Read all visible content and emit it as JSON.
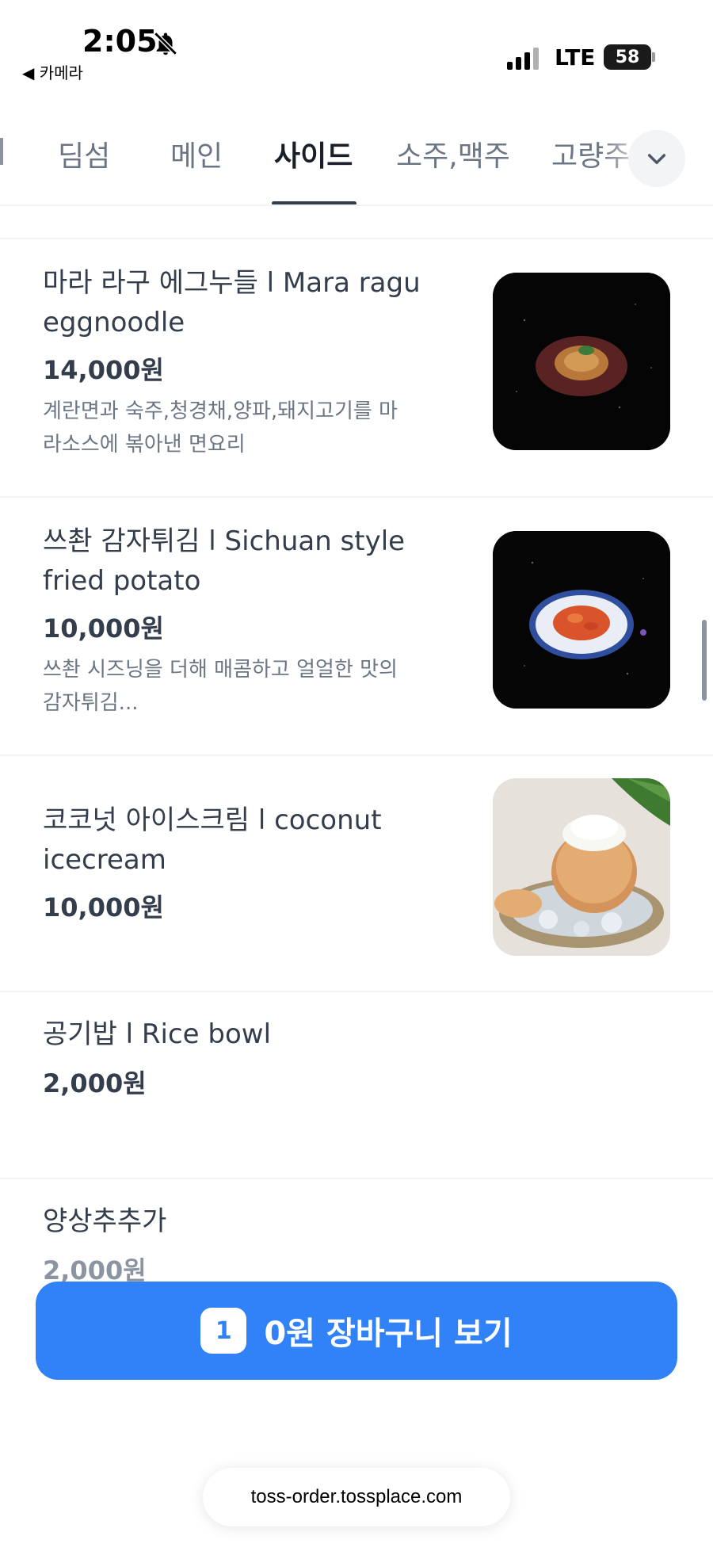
{
  "status_bar": {
    "time": "2:05",
    "back_app": "◀ 카메라",
    "network": "LTE",
    "battery": "58"
  },
  "tabs": [
    {
      "label": "딤섬"
    },
    {
      "label": "메인"
    },
    {
      "label": "사이드",
      "active": true
    },
    {
      "label": "소주,맥주"
    },
    {
      "label": "고량주"
    }
  ],
  "menu_items": [
    {
      "name": "마라 라구 에그누들 l Mara ragu eggnoodle",
      "price": "14,000원",
      "description": "계란면과 숙주,청경채,양파,돼지고기를 마라소스에 볶아낸 면요리"
    },
    {
      "name": "쓰촨 감자튀김 l Sichuan style fried potato",
      "price": "10,000원",
      "description": "쓰촨 시즈닝을 더해 매콤하고 얼얼한 맛의 감자튀김..."
    },
    {
      "name": "코코넛 아이스크림 l coconut icecream",
      "price": "10,000원"
    },
    {
      "name": "공기밥 l Rice bowl",
      "price": "2,000원"
    },
    {
      "name": "양상추추가",
      "price": "2,000원"
    }
  ],
  "cart": {
    "count": "1",
    "label": "0원 장바구니 보기"
  },
  "url": "toss-order.tossplace.com",
  "colors": {
    "accent": "#3182f6",
    "text_primary": "#191f28",
    "text_secondary": "#6b7684"
  }
}
